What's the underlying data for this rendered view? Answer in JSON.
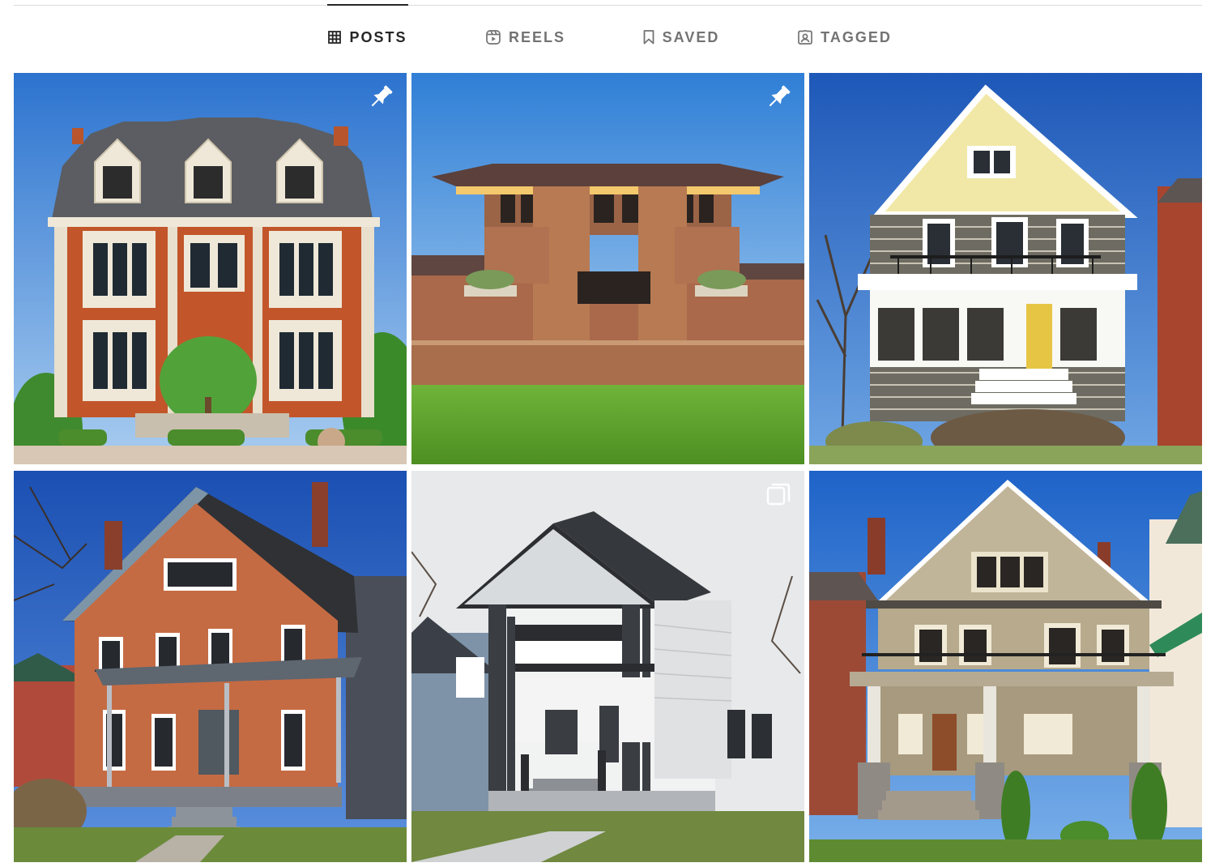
{
  "tabs": [
    {
      "label": "POSTS",
      "icon": "grid-icon",
      "active": true
    },
    {
      "label": "REELS",
      "icon": "reels-icon",
      "active": false
    },
    {
      "label": "SAVED",
      "icon": "bookmark-icon",
      "active": false
    },
    {
      "label": "TAGGED",
      "icon": "tagged-person-icon",
      "active": false
    }
  ],
  "posts": [
    {
      "subject": "Second Empire brick mansion with mansard roof",
      "badge": "pin-icon"
    },
    {
      "subject": "Prairie style brick house with low hipped roof and lawn",
      "badge": "pin-icon"
    },
    {
      "subject": "Shingled two-story house with yellow gable and porch",
      "badge": ""
    },
    {
      "subject": "Brick house with steep gable and front porch",
      "badge": ""
    },
    {
      "subject": "White and black two-story house with double porch",
      "badge": "carousel-icon"
    },
    {
      "subject": "Tan shingled house with large front gable and porch",
      "badge": ""
    }
  ],
  "colors": {
    "active_tab": "#262626",
    "inactive_tab": "#737373",
    "divider": "#dbdbdb",
    "sky": "#2f6fc8"
  }
}
